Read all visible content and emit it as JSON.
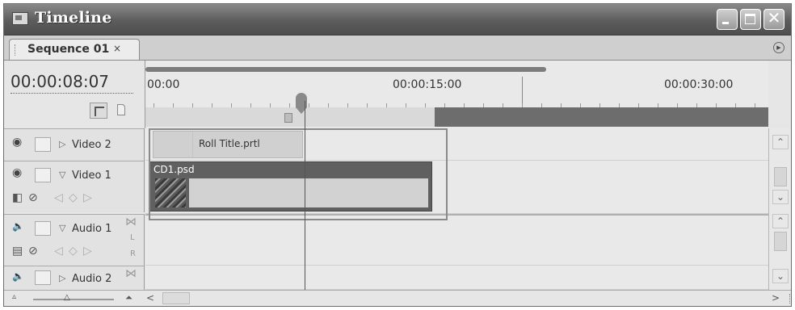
{
  "window": {
    "title": "Timeline"
  },
  "tab": {
    "label": "Sequence 01",
    "close": "×"
  },
  "timecode": "00:00:08:07",
  "ruler": {
    "labels": [
      "00:00",
      "00:00:15:00",
      "00:00:30:00"
    ]
  },
  "tracks": [
    {
      "name": "Video 2",
      "kind": "video",
      "expanded": false
    },
    {
      "name": "Video 1",
      "kind": "video",
      "expanded": true
    },
    {
      "name": "Audio 1",
      "kind": "audio",
      "expanded": true
    },
    {
      "name": "Audio 2",
      "kind": "audio",
      "expanded": false
    }
  ],
  "clips": {
    "roll_title": "Roll Title.prtl",
    "cd1": "CD1.psd"
  },
  "icons": {
    "eye": "eye-icon",
    "speaker": "speaker-icon",
    "snap": "snap-icon",
    "marker": "marker-icon",
    "minimize": "minimize-icon",
    "maximize": "maximize-icon",
    "close": "close-icon"
  },
  "colors": {
    "titlebar": "#5c5c5c",
    "clip_header": "#606060",
    "timebar": "#6d6d6d"
  }
}
